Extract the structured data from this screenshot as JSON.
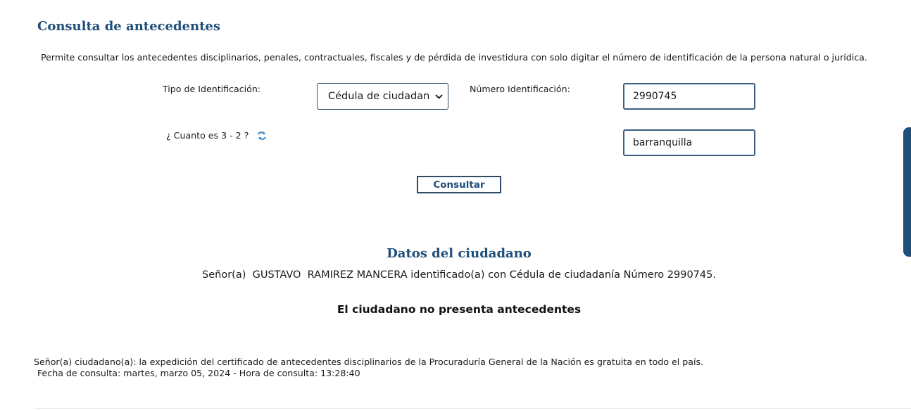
{
  "header": {
    "title": "Consulta de antecedentes",
    "description": "Permite consultar los antecedentes disciplinarios, penales, contractuales, fiscales y de pérdida de investidura con solo digitar el número de identificación de la persona natural o jurídica."
  },
  "form": {
    "id_type_label": "Tipo de Identificación:",
    "id_type_selected": "Cédula de ciudadanía",
    "id_number_label": "Número Identificación:",
    "id_number_value": "2990745",
    "captcha_question": "¿ Cuanto es 3 - 2 ?",
    "captcha_answer": "barranquilla",
    "submit_label": "Consultar"
  },
  "result": {
    "section_title": "Datos del ciudadano",
    "citizen_line": "Señor(a)  GUSTAVO  RAMIREZ MANCERA identificado(a) con Cédula de ciudadanía Número 2990745.",
    "status": "El ciudadano no presenta antecedentes"
  },
  "footer": {
    "note": "Señor(a) ciudadano(a): la expedición del certificado de antecedentes disciplinarios de la Procuraduría General de la Nación es gratuita en todo el país.",
    "query_date": "Fecha de consulta: martes, marzo 05, 2024 - Hora de consulta: 13:28:40"
  },
  "colors": {
    "accent": "#1f4e79",
    "refresh_icon": "#4a90c8"
  },
  "icons": {
    "refresh": "refresh-icon",
    "dropdown": "chevron-down-icon"
  }
}
